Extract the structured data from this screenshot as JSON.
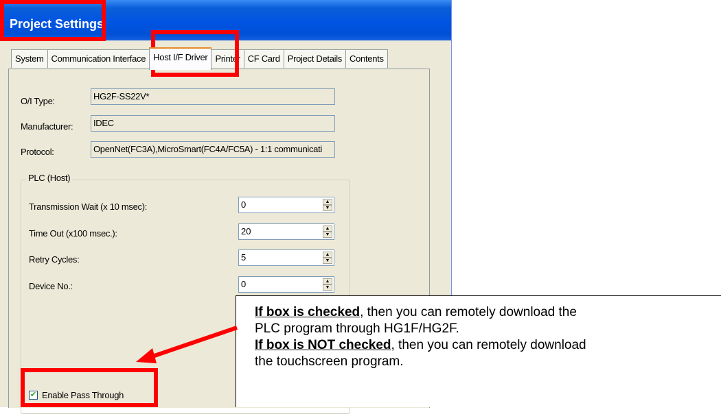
{
  "window": {
    "title": "Project Settings"
  },
  "tabs": [
    {
      "label": "System"
    },
    {
      "label": "Communication Interface"
    },
    {
      "label": "Host I/F Driver"
    },
    {
      "label": "Printer"
    },
    {
      "label": "CF Card"
    },
    {
      "label": "Project Details"
    },
    {
      "label": "Contents"
    }
  ],
  "active_tab": "Host I/F Driver",
  "fields": {
    "oi_type": {
      "label": "O/I Type:",
      "value": "HG2F-SS22V*"
    },
    "manufacturer": {
      "label": "Manufacturer:",
      "value": "IDEC"
    },
    "protocol": {
      "label": "Protocol:",
      "value": "OpenNet(FC3A),MicroSmart(FC4A/FC5A) - 1:1 communicati"
    }
  },
  "plc_group": {
    "title": "PLC (Host)",
    "rows": [
      {
        "label": "Transmission Wait (x 10 msec):",
        "value": "0"
      },
      {
        "label": "Time Out (x100 msec.):",
        "value": "20"
      },
      {
        "label": "Retry Cycles:",
        "value": "5"
      },
      {
        "label": "Device No.:",
        "value": "0"
      }
    ]
  },
  "checkbox": {
    "label": "Enable Pass Through",
    "checked": true,
    "mark": "✔"
  },
  "callout": {
    "line1_bold": "If box is checked",
    "line1_rest": ", then you can remotely download the",
    "line2": "PLC program through HG1F/HG2F.",
    "line3_bold": "If box is NOT checked",
    "line3_rest": ", then you can remotely download",
    "line4": "the touchscreen program."
  },
  "colors": {
    "highlight": "#ff0000",
    "titlebar": "#0054e3",
    "dialog_bg": "#ece9d8"
  }
}
